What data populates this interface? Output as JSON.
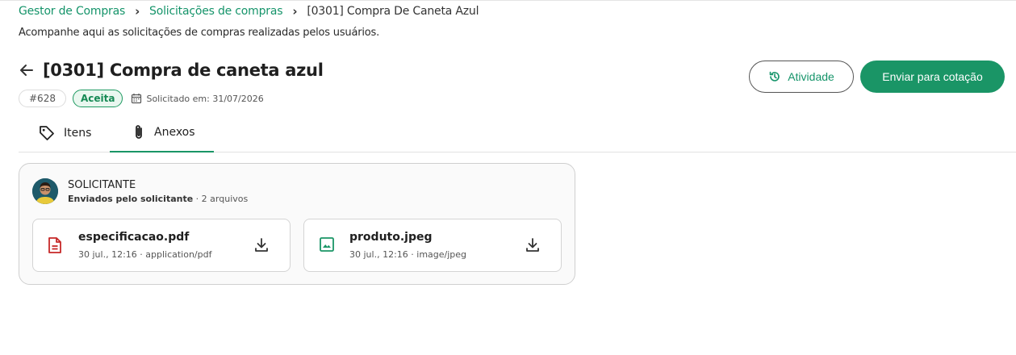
{
  "breadcrumb": {
    "items": [
      "Gestor de Compras",
      "Solicitações de compras"
    ],
    "current": "[0301] Compra De Caneta Azul",
    "separator_icon": "chevron-right-icon"
  },
  "subtitle": "Acompanhe aqui as solicitações de compras realizadas pelos usuários.",
  "header": {
    "back_icon": "arrow-left-icon",
    "title": "[0301] Compra de caneta azul",
    "id_chip": "#628",
    "status": "Aceita",
    "date_label": "Solicitado em: 31/07/2026"
  },
  "actions": {
    "activity_label": "Atividade",
    "send_label": "Enviar para cotação"
  },
  "tabs": [
    {
      "label": "Itens",
      "icon": "tag-icon",
      "active": false
    },
    {
      "label": "Anexos",
      "icon": "paperclip-icon",
      "active": true
    }
  ],
  "attachments": {
    "requester_role": "SOLICITANTE",
    "sent_by": "Enviados pelo solicitante",
    "file_count": " · 2 arquivos",
    "files": [
      {
        "name": "especificacao.pdf",
        "meta": "30 jul., 12:16 · application/pdf",
        "icon": "pdf-file-icon"
      },
      {
        "name": "produto.jpeg",
        "meta": "30 jul., 12:16 · image/jpeg",
        "icon": "image-file-icon"
      }
    ]
  },
  "colors": {
    "primary": "#1a9566",
    "link": "#15946a",
    "pdf": "#c62828",
    "image": "#1a9566"
  }
}
